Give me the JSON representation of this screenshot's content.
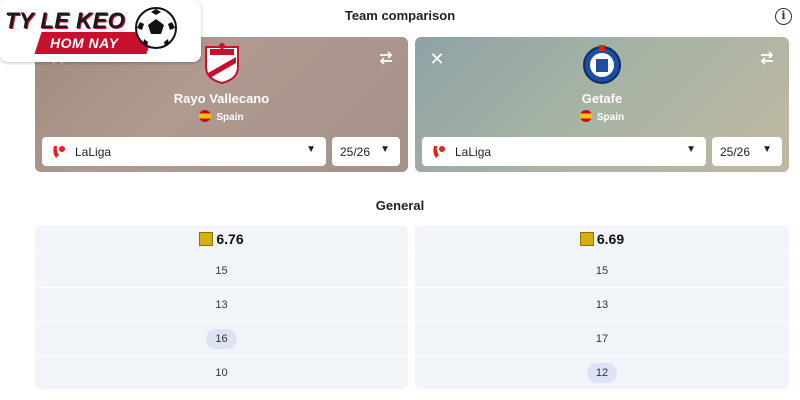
{
  "header": {
    "title": "Team comparison"
  },
  "brand": {
    "line1": "TY LE KEO",
    "line2": "HOM NAY"
  },
  "teams": [
    {
      "name": "Rayo Vallecano",
      "country": "Spain",
      "league": "LaLiga",
      "season": "25/26"
    },
    {
      "name": "Getafe",
      "country": "Spain",
      "league": "LaLiga",
      "season": "25/26"
    }
  ],
  "general": {
    "title": "General",
    "left": {
      "rating": "6.76",
      "rows": [
        "15",
        "13",
        "16",
        "10"
      ],
      "highlighted": [
        2
      ]
    },
    "right": {
      "rating": "6.69",
      "rows": [
        "15",
        "13",
        "17",
        "12"
      ],
      "highlighted": [
        3
      ]
    }
  },
  "colors": {
    "rating_badge": "#d4b00a",
    "highlight_pill": "#dde3f7",
    "brand_red": "#c8102e"
  }
}
